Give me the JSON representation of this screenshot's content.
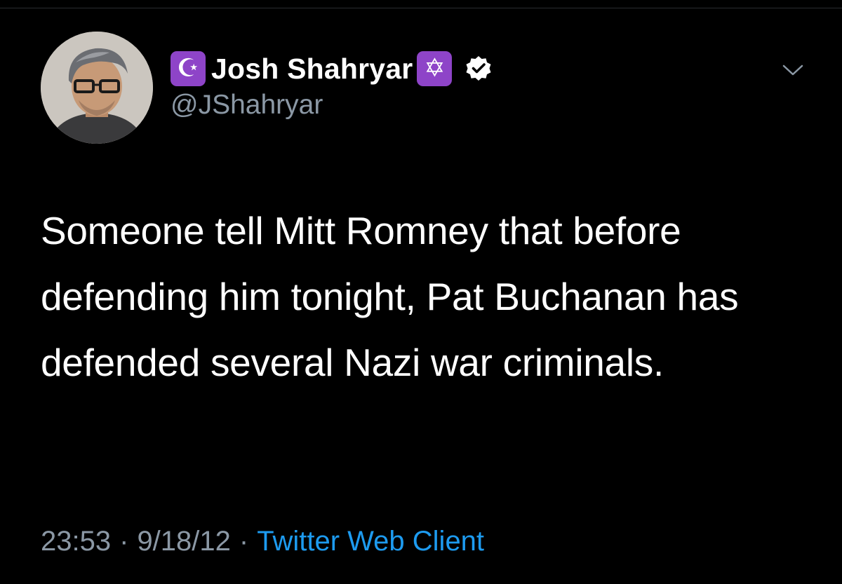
{
  "author": {
    "display_name": "Josh Shahryar",
    "handle": "@JShahryar",
    "prefix_emoji_icon": "star-and-crescent-icon",
    "prefix_emoji_glyph": "☪",
    "suffix_emoji_icon": "star-of-david-icon",
    "suffix_emoji_glyph": "✡",
    "verified": true
  },
  "tweet": {
    "text": "Someone tell Mitt Romney that before defending him tonight, Pat Buchanan has defended several Nazi war criminals.",
    "time": "23:53",
    "date": "9/18/12",
    "separator": "·",
    "client": "Twitter Web Client"
  },
  "colors": {
    "background": "#000000",
    "text": "#ffffff",
    "secondary": "#8b98a5",
    "link": "#1d9bf0",
    "emoji_badge": "#8e44c8"
  }
}
